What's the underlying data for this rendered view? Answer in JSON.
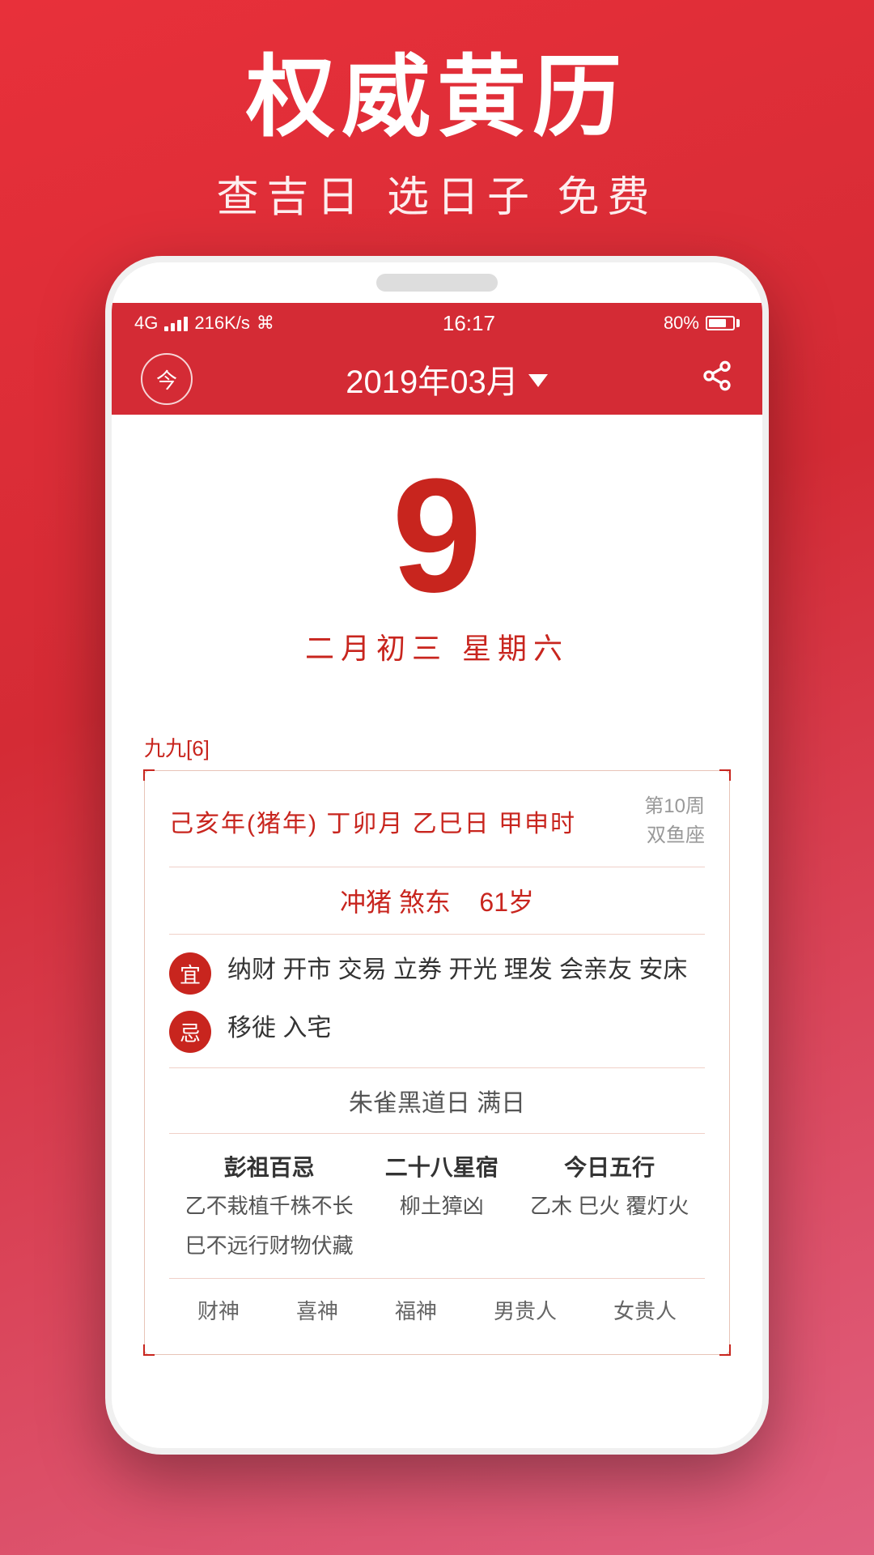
{
  "app": {
    "main_title": "权威黄历",
    "sub_title": "查吉日 选日子 免费"
  },
  "status_bar": {
    "signal": "4G",
    "network_speed": "216K/s",
    "time": "16:17",
    "battery_percent": "80%"
  },
  "nav": {
    "today_label": "今",
    "month_label": "2019年03月",
    "dropdown_symbol": "▼"
  },
  "calendar": {
    "day": "9",
    "lunar_label": "二月初三  星期六",
    "nine_nine": "九九[6]",
    "year_info": "己亥年(猪年) 丁卯月  乙巳日  甲申时",
    "week_label": "第10周",
    "zodiac": "双鱼座",
    "conflict": "冲猪  煞东",
    "age": "61岁",
    "yi_label": "宜",
    "yi_text": "纳财 开市 交易 立券 开光 理发 会亲友 安床",
    "ji_label": "忌",
    "ji_text": "移徙 入宅",
    "special_day": "朱雀黑道日   满日",
    "col1_title": "彭祖百忌",
    "col1_line1": "乙不栽植千株不长",
    "col1_line2": "巳不远行财物伏藏",
    "col2_title": "二十八星宿",
    "col2_value": "柳土獐凶",
    "col3_title": "今日五行",
    "col3_value": "乙木 巳火 覆灯火",
    "bottom_items": [
      "财神",
      "喜神",
      "福神",
      "男贵人",
      "女贵人"
    ]
  }
}
